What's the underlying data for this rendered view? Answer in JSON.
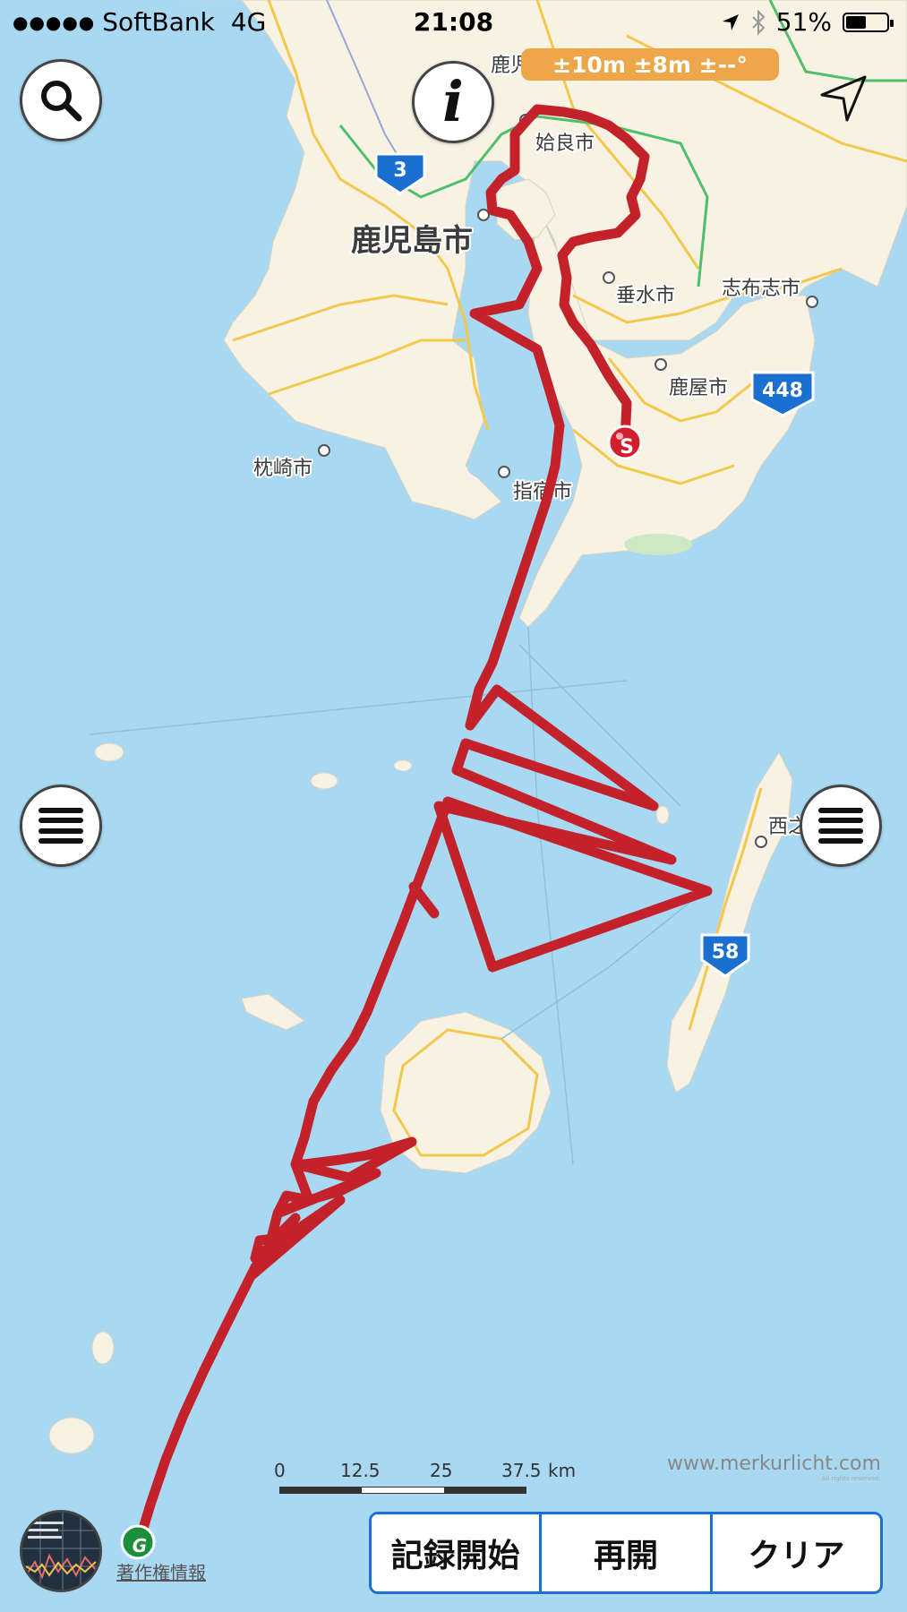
{
  "status_bar": {
    "signal_dots": "●●●●●",
    "carrier": "SoftBank",
    "network": "4G",
    "time": "21:08",
    "battery_percent": "51%",
    "battery_level": 0.51,
    "icons": [
      "location-arrow-icon",
      "bluetooth-icon",
      "battery-icon"
    ]
  },
  "controls": {
    "search_icon": "search-icon",
    "info_glyph": "i",
    "compass_icon": "navigation-arrow-icon",
    "left_menu_icon": "hamburger-menu-icon",
    "right_menu_icon": "hamburger-menu-icon"
  },
  "accuracy_badge": "±10m ±8m ±--°",
  "map_labels": {
    "kagoshima_pref": "鹿児島県",
    "aira": "姶良市",
    "kagoshima_city": "鹿児島市",
    "tarumizu": "垂水市",
    "shibushi": "志布志市",
    "kanoya": "鹿屋市",
    "makurazaki": "枕崎市",
    "ibusuki": "指宿市",
    "nishinoomote": "西之"
  },
  "route_shields": [
    "3",
    "448",
    "58"
  ],
  "markers": {
    "start": "S",
    "goal": "G"
  },
  "scale_bar": {
    "ticks": [
      "0",
      "12.5",
      "25",
      "37.5"
    ],
    "unit": "km"
  },
  "watermark": {
    "text": "www.merkurlicht.com",
    "subtext": "All rights reserved."
  },
  "copyright_link": "著作権情報",
  "toolbar": {
    "start_recording": "記録開始",
    "resume": "再開",
    "clear": "クリア"
  },
  "colors": {
    "sea": "#a9d8f2",
    "land": "#f7f2e3",
    "track": "#c4222a",
    "toolbar_border": "#1c6fd6",
    "accuracy_badge": "#eda64a",
    "highway": "#f2c94c",
    "expressway": "#4fbf6a",
    "route_shield": "#1b6fd0"
  }
}
